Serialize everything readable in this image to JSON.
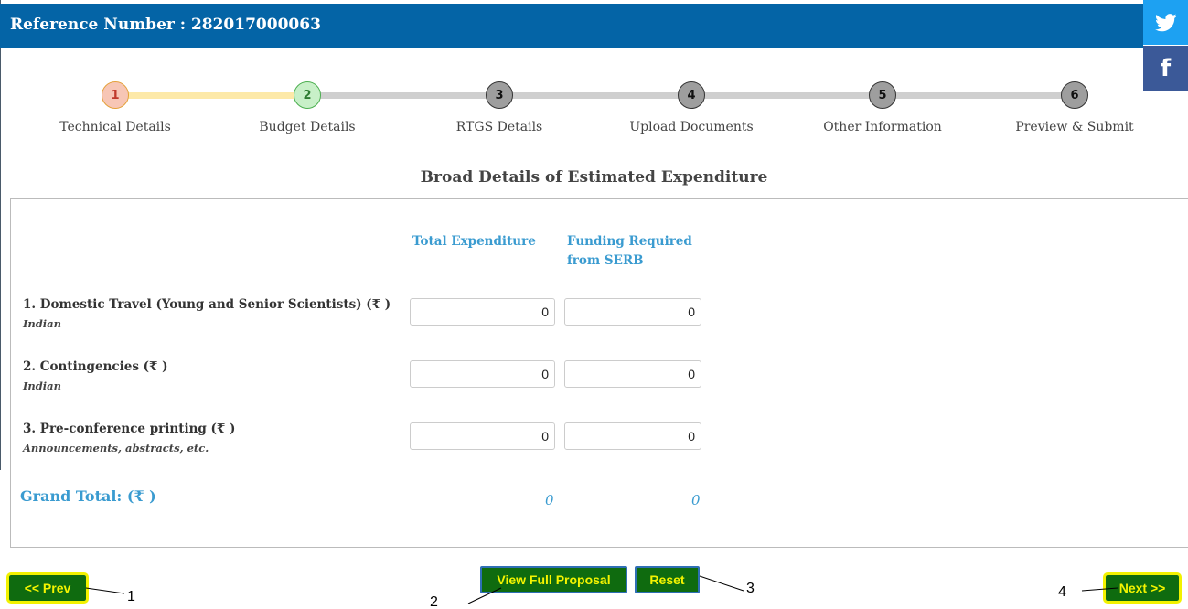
{
  "header": {
    "title": "Reference Number : 282017000063"
  },
  "social": {
    "twitter_icon": "twitter-bird-icon",
    "facebook_glyph": "f"
  },
  "steps": [
    {
      "number": "1",
      "label": "Technical Details"
    },
    {
      "number": "2",
      "label": "Budget Details"
    },
    {
      "number": "3",
      "label": "RTGS Details"
    },
    {
      "number": "4",
      "label": "Upload Documents"
    },
    {
      "number": "5",
      "label": "Other Information"
    },
    {
      "number": "6",
      "label": "Preview & Submit"
    }
  ],
  "colors": {
    "header": "#0464a6",
    "accent": "#3a9bd0",
    "button": "#0f6b0f",
    "button_text": "#f4f400",
    "step1": "#f7c6b5",
    "step2": "#c8f0c8",
    "step_inactive": "#9e9e9e"
  },
  "section_title": "Broad Details of Estimated Expenditure",
  "columns": {
    "total": "Total Expenditure",
    "funding_line1": "Funding Required",
    "funding_line2": "from SERB"
  },
  "rows": [
    {
      "label": "1.  Domestic Travel (Young and Senior Scientists)  (₹ )",
      "sub": "Indian",
      "total": "0",
      "funding": "0"
    },
    {
      "label": "2.  Contingencies  (₹ )",
      "sub": "Indian",
      "total": "0",
      "funding": "0"
    },
    {
      "label": "3.  Pre-conference printing  (₹ )",
      "sub": "Announcements, abstracts, etc.",
      "total": "0",
      "funding": "0"
    }
  ],
  "grand_total": {
    "label": "Grand Total:  (₹ )",
    "total": "0",
    "funding": "0"
  },
  "buttons": {
    "prev": "<< Prev",
    "view": "View Full Proposal",
    "reset": "Reset",
    "next": "Next >>"
  },
  "annotations": [
    "1",
    "2",
    "3",
    "4"
  ]
}
